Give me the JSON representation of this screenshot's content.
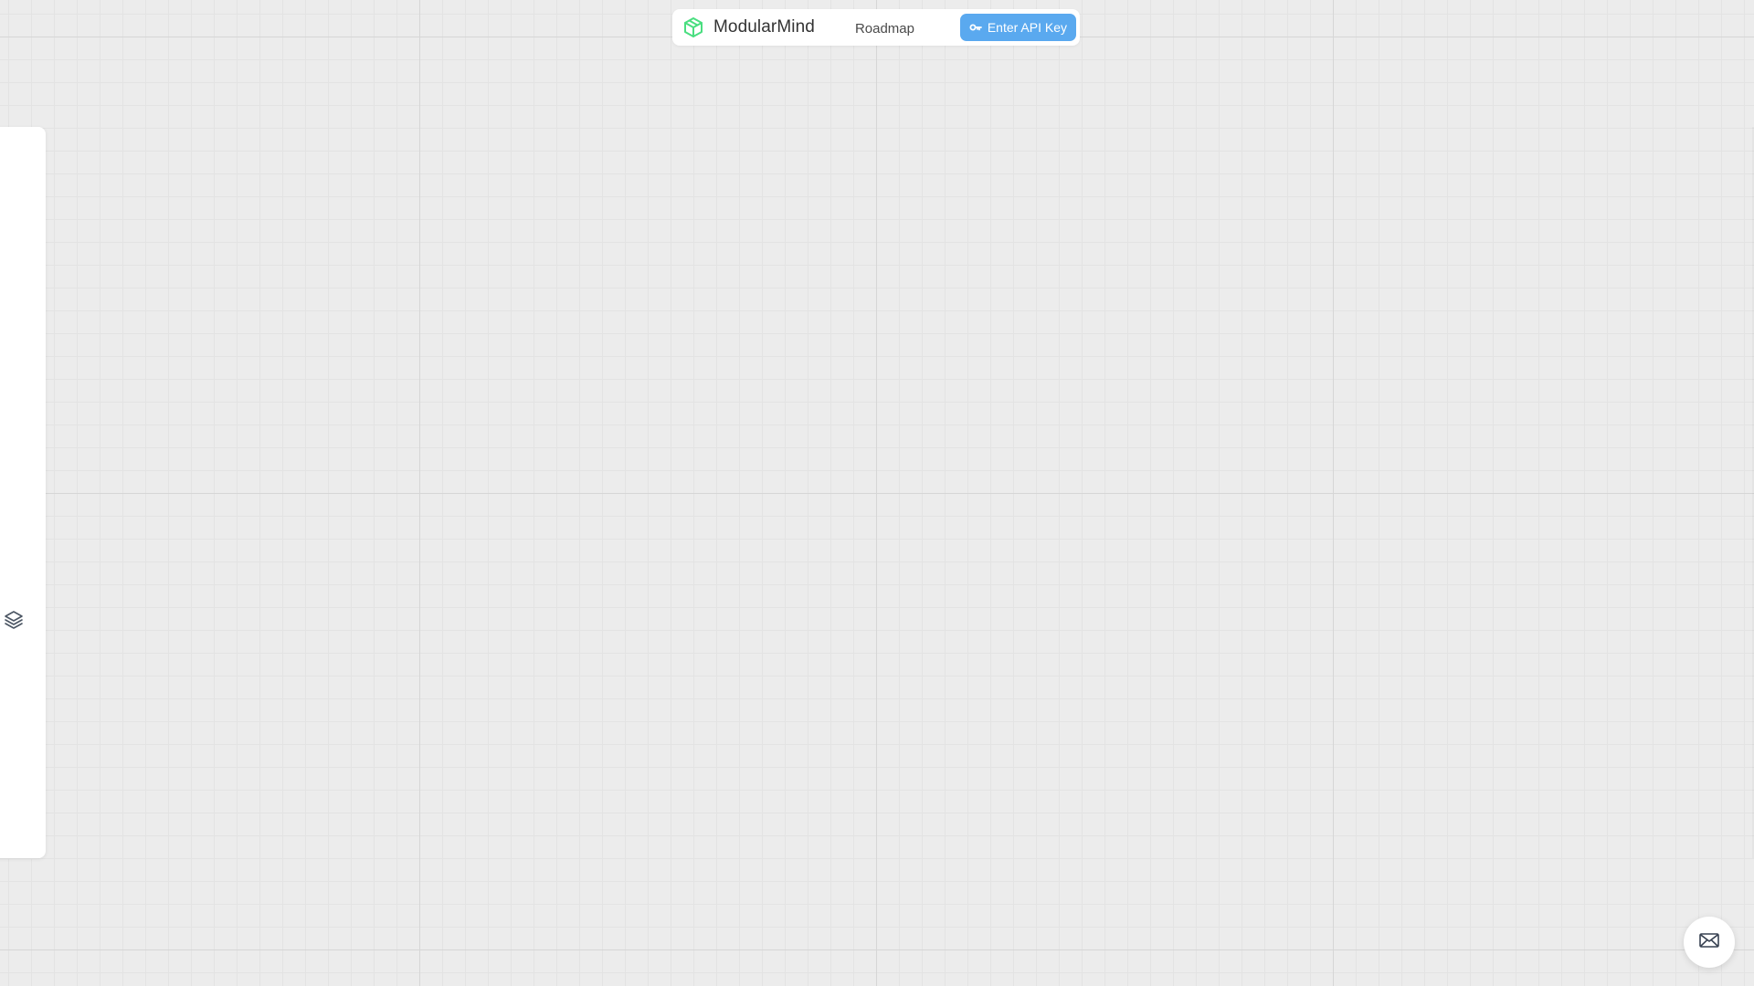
{
  "header": {
    "brand_name": "ModularMind",
    "logo_icon": "modularmind-logo-icon",
    "nav_roadmap_label": "Roadmap",
    "api_key_button_label": "Enter API Key",
    "api_key_icon": "key-icon"
  },
  "sidebar": {
    "toggle_icon": "layers-icon"
  },
  "floating": {
    "contact_icon": "mail-icon"
  },
  "colors": {
    "canvas_background": "#ececec",
    "grid_major": "#d6d6d6",
    "grid_minor": "#e3e3e3",
    "brand_accent": "#4ade80",
    "button_primary": "#5aa9ef",
    "panel_background": "#ffffff"
  }
}
